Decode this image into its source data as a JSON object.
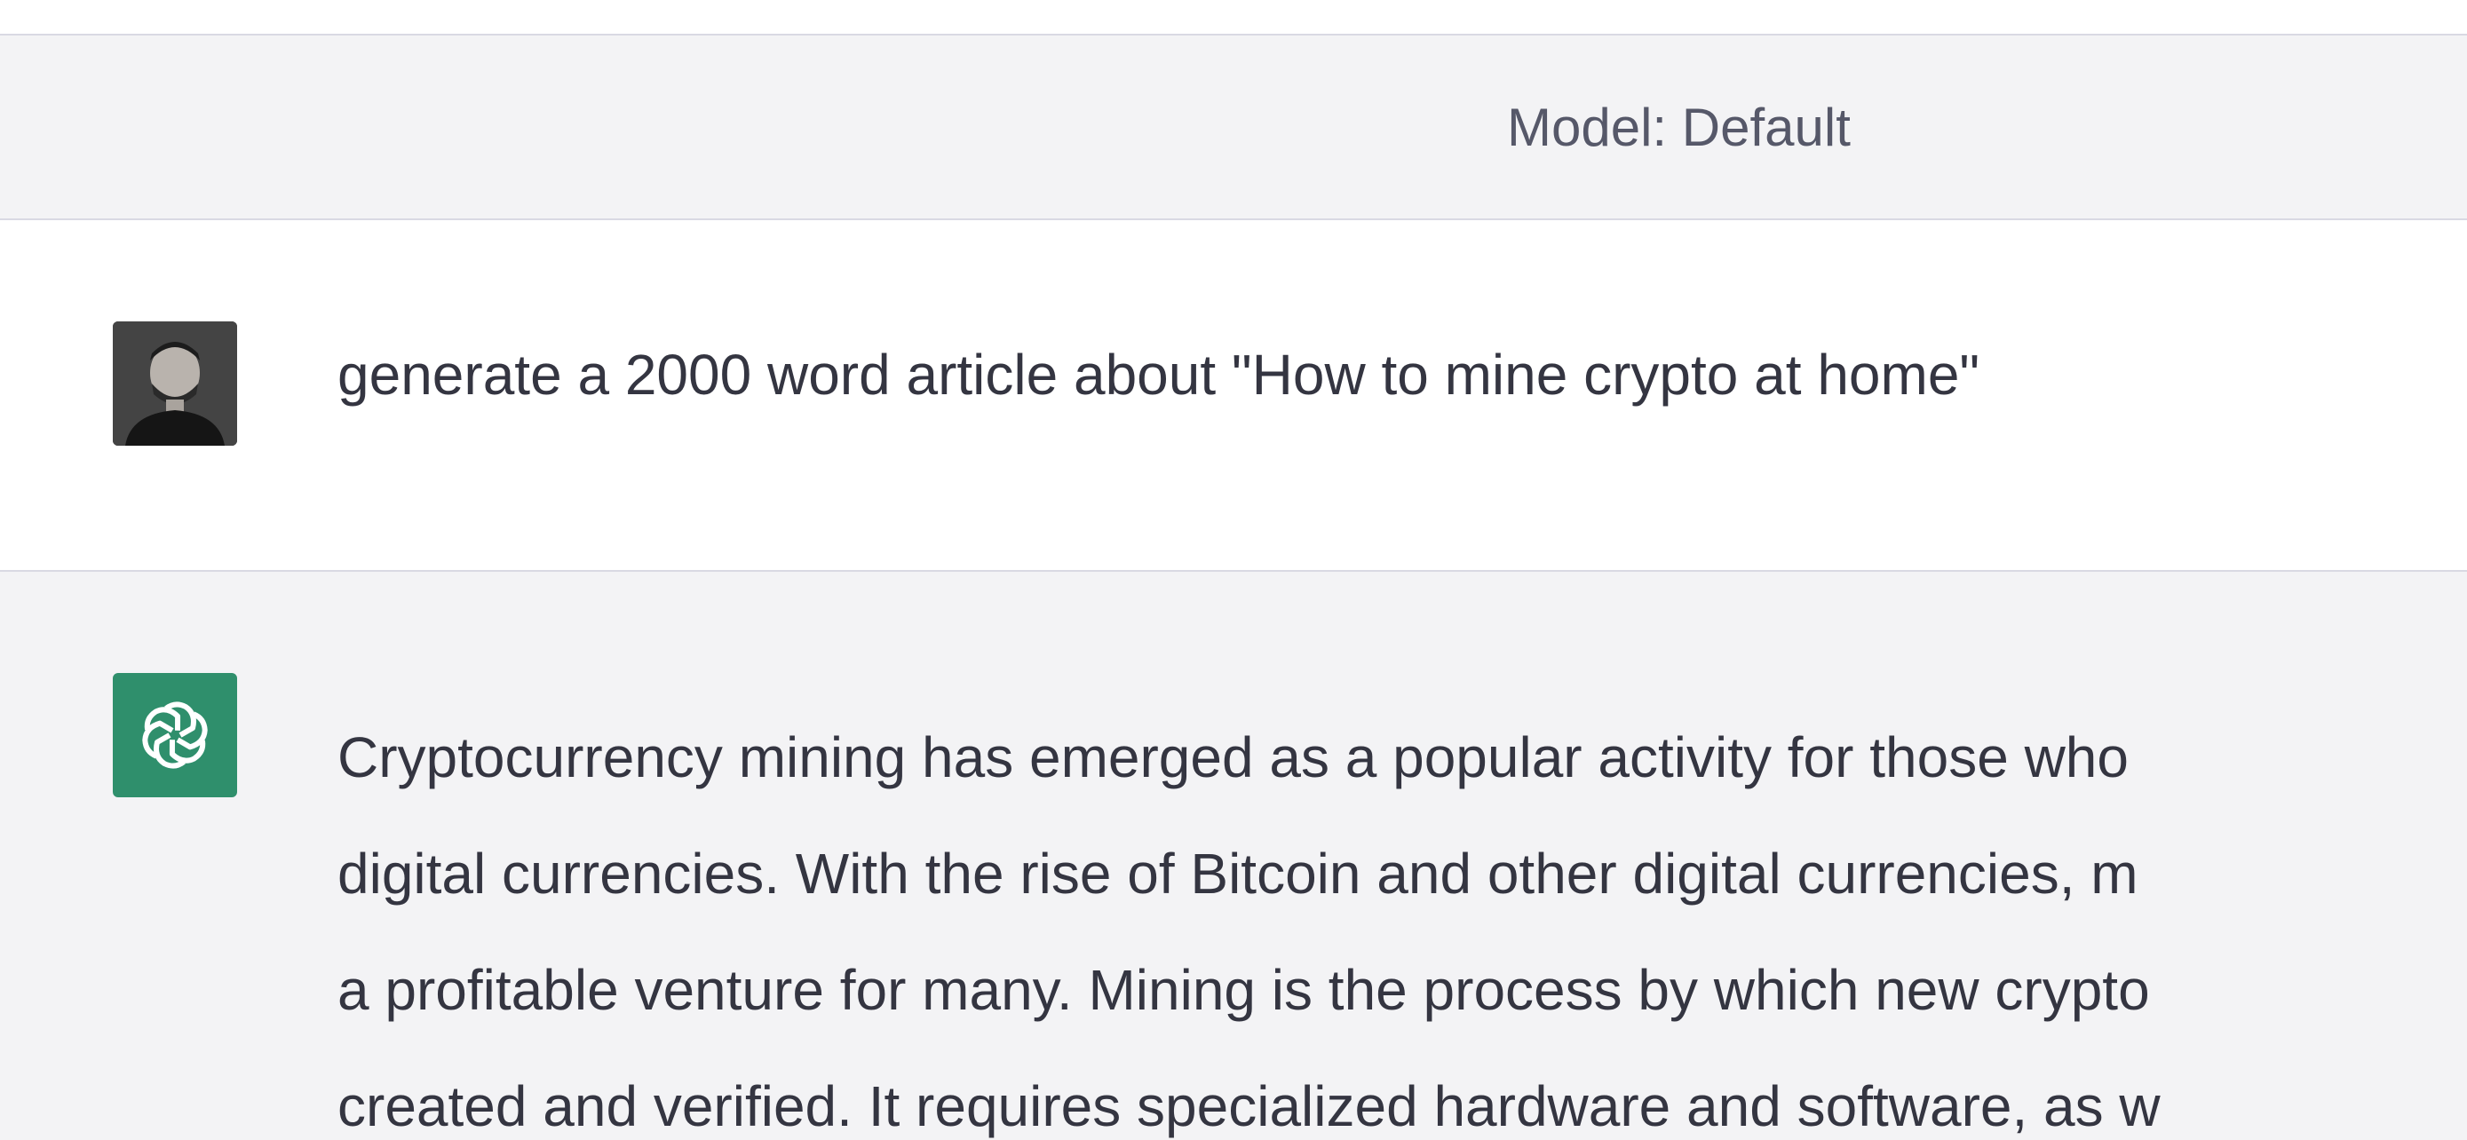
{
  "header": {
    "model_label": "Model: Default"
  },
  "conversation": {
    "user_message": {
      "avatar": "user-avatar-photo",
      "text": "generate a 2000 word article about \"How to mine crypto at home\""
    },
    "assistant_message": {
      "icon": "openai-logo-icon",
      "lines": [
        "Cryptocurrency mining has emerged as a popular activity for those who",
        "digital currencies. With the rise of Bitcoin and other digital currencies, m",
        "a profitable venture for many. Mining is the process by which new crypto",
        "created and verified. It requires specialized hardware and software, as w"
      ]
    }
  },
  "colors": {
    "assistant_icon_bg": "#2f8f6c",
    "row_bg_alt": "#f3f3f5",
    "divider": "#d9d9e3",
    "text": "#343541"
  }
}
